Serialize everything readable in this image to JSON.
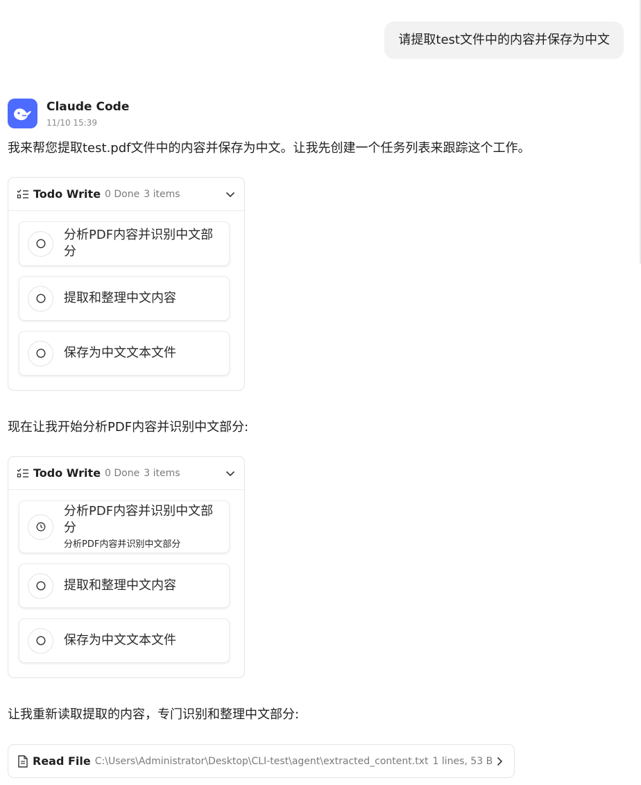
{
  "user_message": "请提取test文件中的内容并保存为中文",
  "assistant": {
    "name": "Claude Code",
    "time": "11/10 15:39"
  },
  "intro_text": "我来帮您提取test.pdf文件中的内容并保存为中文。让我先创建一个任务列表来跟踪这个工作。",
  "todo_cards": [
    {
      "title": "Todo Write",
      "done": "0 Done",
      "items_count": "3 items",
      "items": [
        {
          "label": "分析PDF内容并识别中文部分",
          "status": "pending"
        },
        {
          "label": "提取和整理中文内容",
          "status": "pending"
        },
        {
          "label": "保存为中文文本文件",
          "status": "pending"
        }
      ]
    },
    {
      "title": "Todo Write",
      "done": "0 Done",
      "items_count": "3 items",
      "items": [
        {
          "label": "分析PDF内容并识别中文部分",
          "sublabel": "分析PDF内容并识别中文部分",
          "status": "in_progress"
        },
        {
          "label": "提取和整理中文内容",
          "status": "pending"
        },
        {
          "label": "保存为中文文本文件",
          "status": "pending"
        }
      ]
    }
  ],
  "analysis_text": "现在让我开始分析PDF内容并识别中文部分:",
  "reread_text": "让我重新读取提取的内容，专门识别和整理中文部分:",
  "read_file": {
    "title": "Read File",
    "path": "C:\\Users\\Administrator\\Desktop\\CLI-test\\agent\\extracted_content.txt",
    "meta": "1 lines, 53 B"
  },
  "icons": {
    "avatar": "whale-logo-icon",
    "todo": "checklist-icon",
    "pending": "empty-circle-icon",
    "in_progress": "clock-icon",
    "file": "file-icon",
    "expand": "chevron-down-icon",
    "open": "chevron-right-icon"
  },
  "colors": {
    "brand": "#4d6bfe",
    "bubble": "#f2f2f2"
  }
}
